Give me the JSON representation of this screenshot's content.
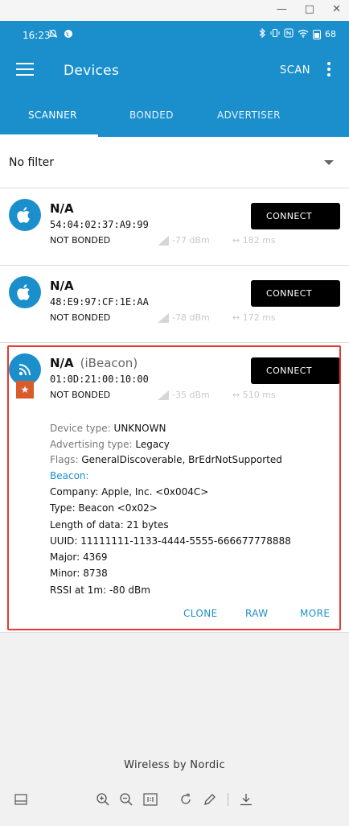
{
  "window": {
    "controls": [
      "—",
      "□",
      "✕"
    ]
  },
  "status_bar": {
    "time": "16:23",
    "battery": "68"
  },
  "app_bar": {
    "title": "Devices",
    "action": "SCAN"
  },
  "tabs": [
    {
      "label": "SCANNER",
      "active": true
    },
    {
      "label": "BONDED",
      "active": false
    },
    {
      "label": "ADVERTISER",
      "active": false
    }
  ],
  "filter": {
    "value": "No filter"
  },
  "devices": [
    {
      "name": "N/A",
      "mac": "54:04:02:37:A9:99",
      "bond": "NOT BONDED",
      "rssi": "-77 dBm",
      "interval": "182 ms",
      "connect": "CONNECT",
      "icon": "apple-icon"
    },
    {
      "name": "N/A",
      "mac": "48:E9:97:CF:1E:AA",
      "bond": "NOT BONDED",
      "rssi": "-78 dBm",
      "interval": "172 ms",
      "connect": "CONNECT",
      "icon": "apple-icon"
    },
    {
      "name": "N/A",
      "name_suffix": "(iBeacon)",
      "mac": "01:0D:21:00:10:00",
      "bond": "NOT BONDED",
      "rssi": "-35 dBm",
      "interval": "510 ms",
      "connect": "CONNECT",
      "icon": "beacon-icon",
      "details": {
        "device_type_label": "Device type:",
        "device_type": "UNKNOWN",
        "adv_type_label": "Advertising type:",
        "adv_type": "Legacy",
        "flags_label": "Flags:",
        "flags": "GeneralDiscoverable, BrEdrNotSupported",
        "beacon_header": "Beacon:",
        "company": "Company: Apple, Inc. <0x004C>",
        "type": "Type: Beacon <0x02>",
        "length": "Length of data: 21 bytes",
        "uuid": "UUID: 11111111-1133-4444-5555-666677778888",
        "major": "Major: 4369",
        "minor": "Minor: 8738",
        "rssi_1m": "RSSI at 1m: -80 dBm"
      },
      "actions": {
        "clone": "CLONE",
        "raw": "RAW",
        "more": "MORE"
      }
    }
  ],
  "footer": "Wireless by Nordic",
  "colors": {
    "primary": "#1a8fcc",
    "highlight": "#e53935",
    "badge": "#d95a2b"
  }
}
